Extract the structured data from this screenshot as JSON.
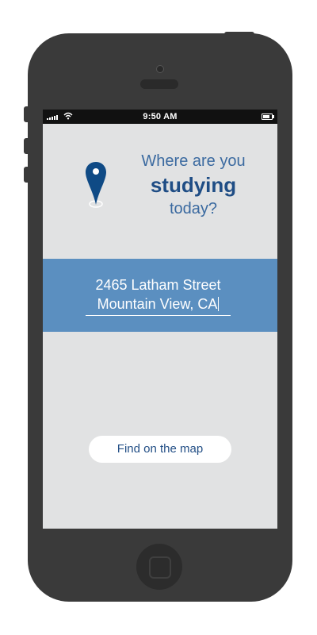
{
  "status_bar": {
    "time": "9:50 AM",
    "icons": [
      "signal-icon",
      "wifi-icon",
      "battery-icon"
    ]
  },
  "prompt": {
    "line1": "Where are you",
    "line2": "studying",
    "line3": "today?"
  },
  "address": {
    "line1": "2465 Latham Street",
    "line2": "Mountain View, CA"
  },
  "map_button": {
    "label": "Find on the map"
  },
  "colors": {
    "brand_blue": "#1f4d85",
    "band_blue": "#5b8fc0",
    "screen_bg": "#e1e2e3",
    "phone_body": "#3a3a3a"
  },
  "icons": {
    "location": "location-pin-icon"
  }
}
